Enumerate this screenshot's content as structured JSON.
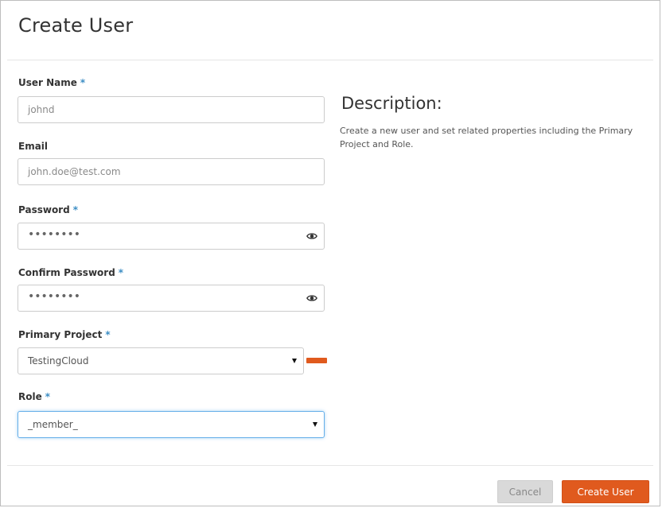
{
  "dialog": {
    "title": "Create User"
  },
  "form": {
    "required_marker": "*",
    "username": {
      "label": "User Name",
      "value": "johnd"
    },
    "email": {
      "label": "Email",
      "value": "john.doe@test.com"
    },
    "password": {
      "label": "Password",
      "masked_value": "••••••••"
    },
    "confirm_password": {
      "label": "Confirm Password",
      "masked_value": "••••••••"
    },
    "primary_project": {
      "label": "Primary Project",
      "selected": "TestingCloud"
    },
    "role": {
      "label": "Role",
      "selected": "_member_"
    }
  },
  "description": {
    "heading": "Description:",
    "body": "Create a new user and set related properties including the Primary Project and Role."
  },
  "footer": {
    "cancel_label": "Cancel",
    "submit_label": "Create User"
  },
  "colors": {
    "accent": "#e05a1e",
    "required": "#3c8dc4",
    "focus": "#66afe9"
  },
  "icons": {
    "password_toggle": "eye-icon",
    "select_caret": "caret-down-icon"
  }
}
